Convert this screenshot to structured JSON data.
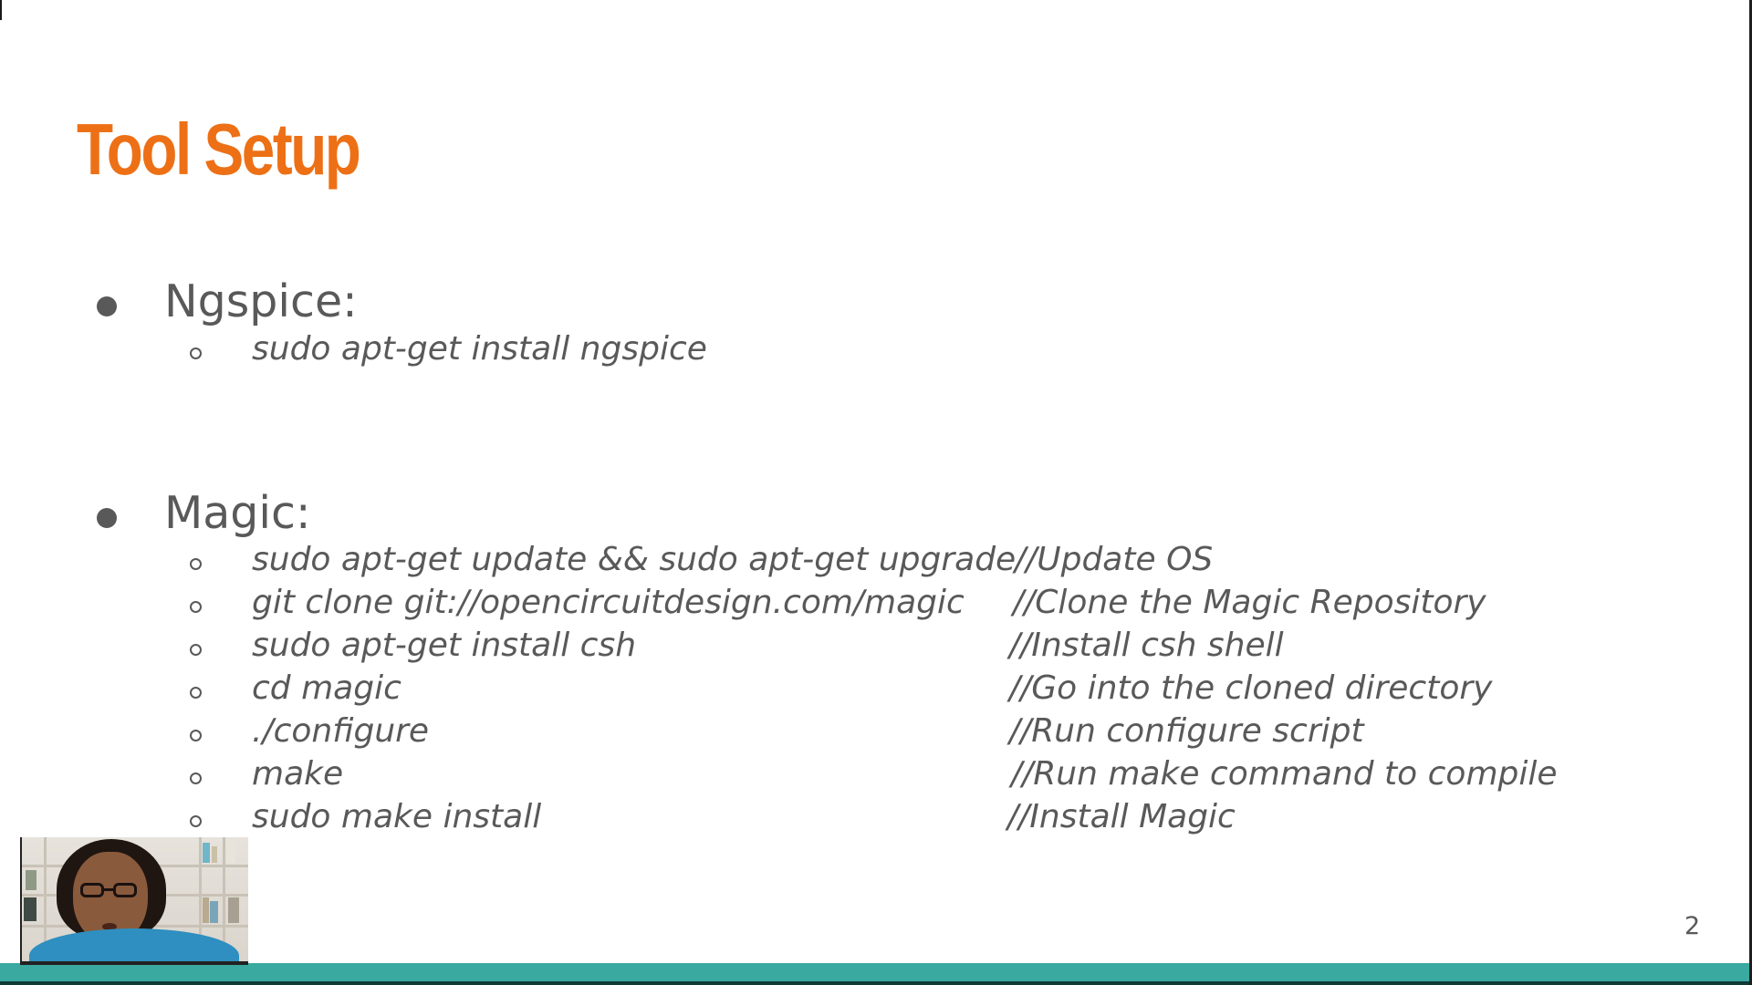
{
  "slide": {
    "title": "Tool Setup",
    "page_number": "2",
    "sections": [
      {
        "heading": "Ngspice:",
        "commands": [
          {
            "command": "sudo apt-get install ngspice",
            "comment": ""
          }
        ]
      },
      {
        "heading": "Magic:",
        "commands": [
          {
            "command": "sudo apt-get update && sudo apt-get upgrade",
            "comment": "//Update OS"
          },
          {
            "command": "git clone git://opencircuitdesign.com/magic",
            "comment": "//Clone the Magic Repository"
          },
          {
            "command": "sudo apt-get install csh",
            "comment": "//Install csh shell"
          },
          {
            "command": "cd magic",
            "comment": "//Go into the cloned directory"
          },
          {
            "command": "./configure",
            "comment": "//Run configure script"
          },
          {
            "command": "make",
            "comment": "//Run make command to compile"
          },
          {
            "command": "sudo make install",
            "comment": "//Install Magic"
          }
        ]
      }
    ]
  },
  "colors": {
    "title": "#ed7016",
    "body_text": "#595959",
    "footer_bar": "#3aa9a0",
    "webcam_shirt": "#2e8fc0"
  },
  "icons": {
    "bullet": "filled-circle",
    "sub_bullet": "hollow-circle"
  }
}
